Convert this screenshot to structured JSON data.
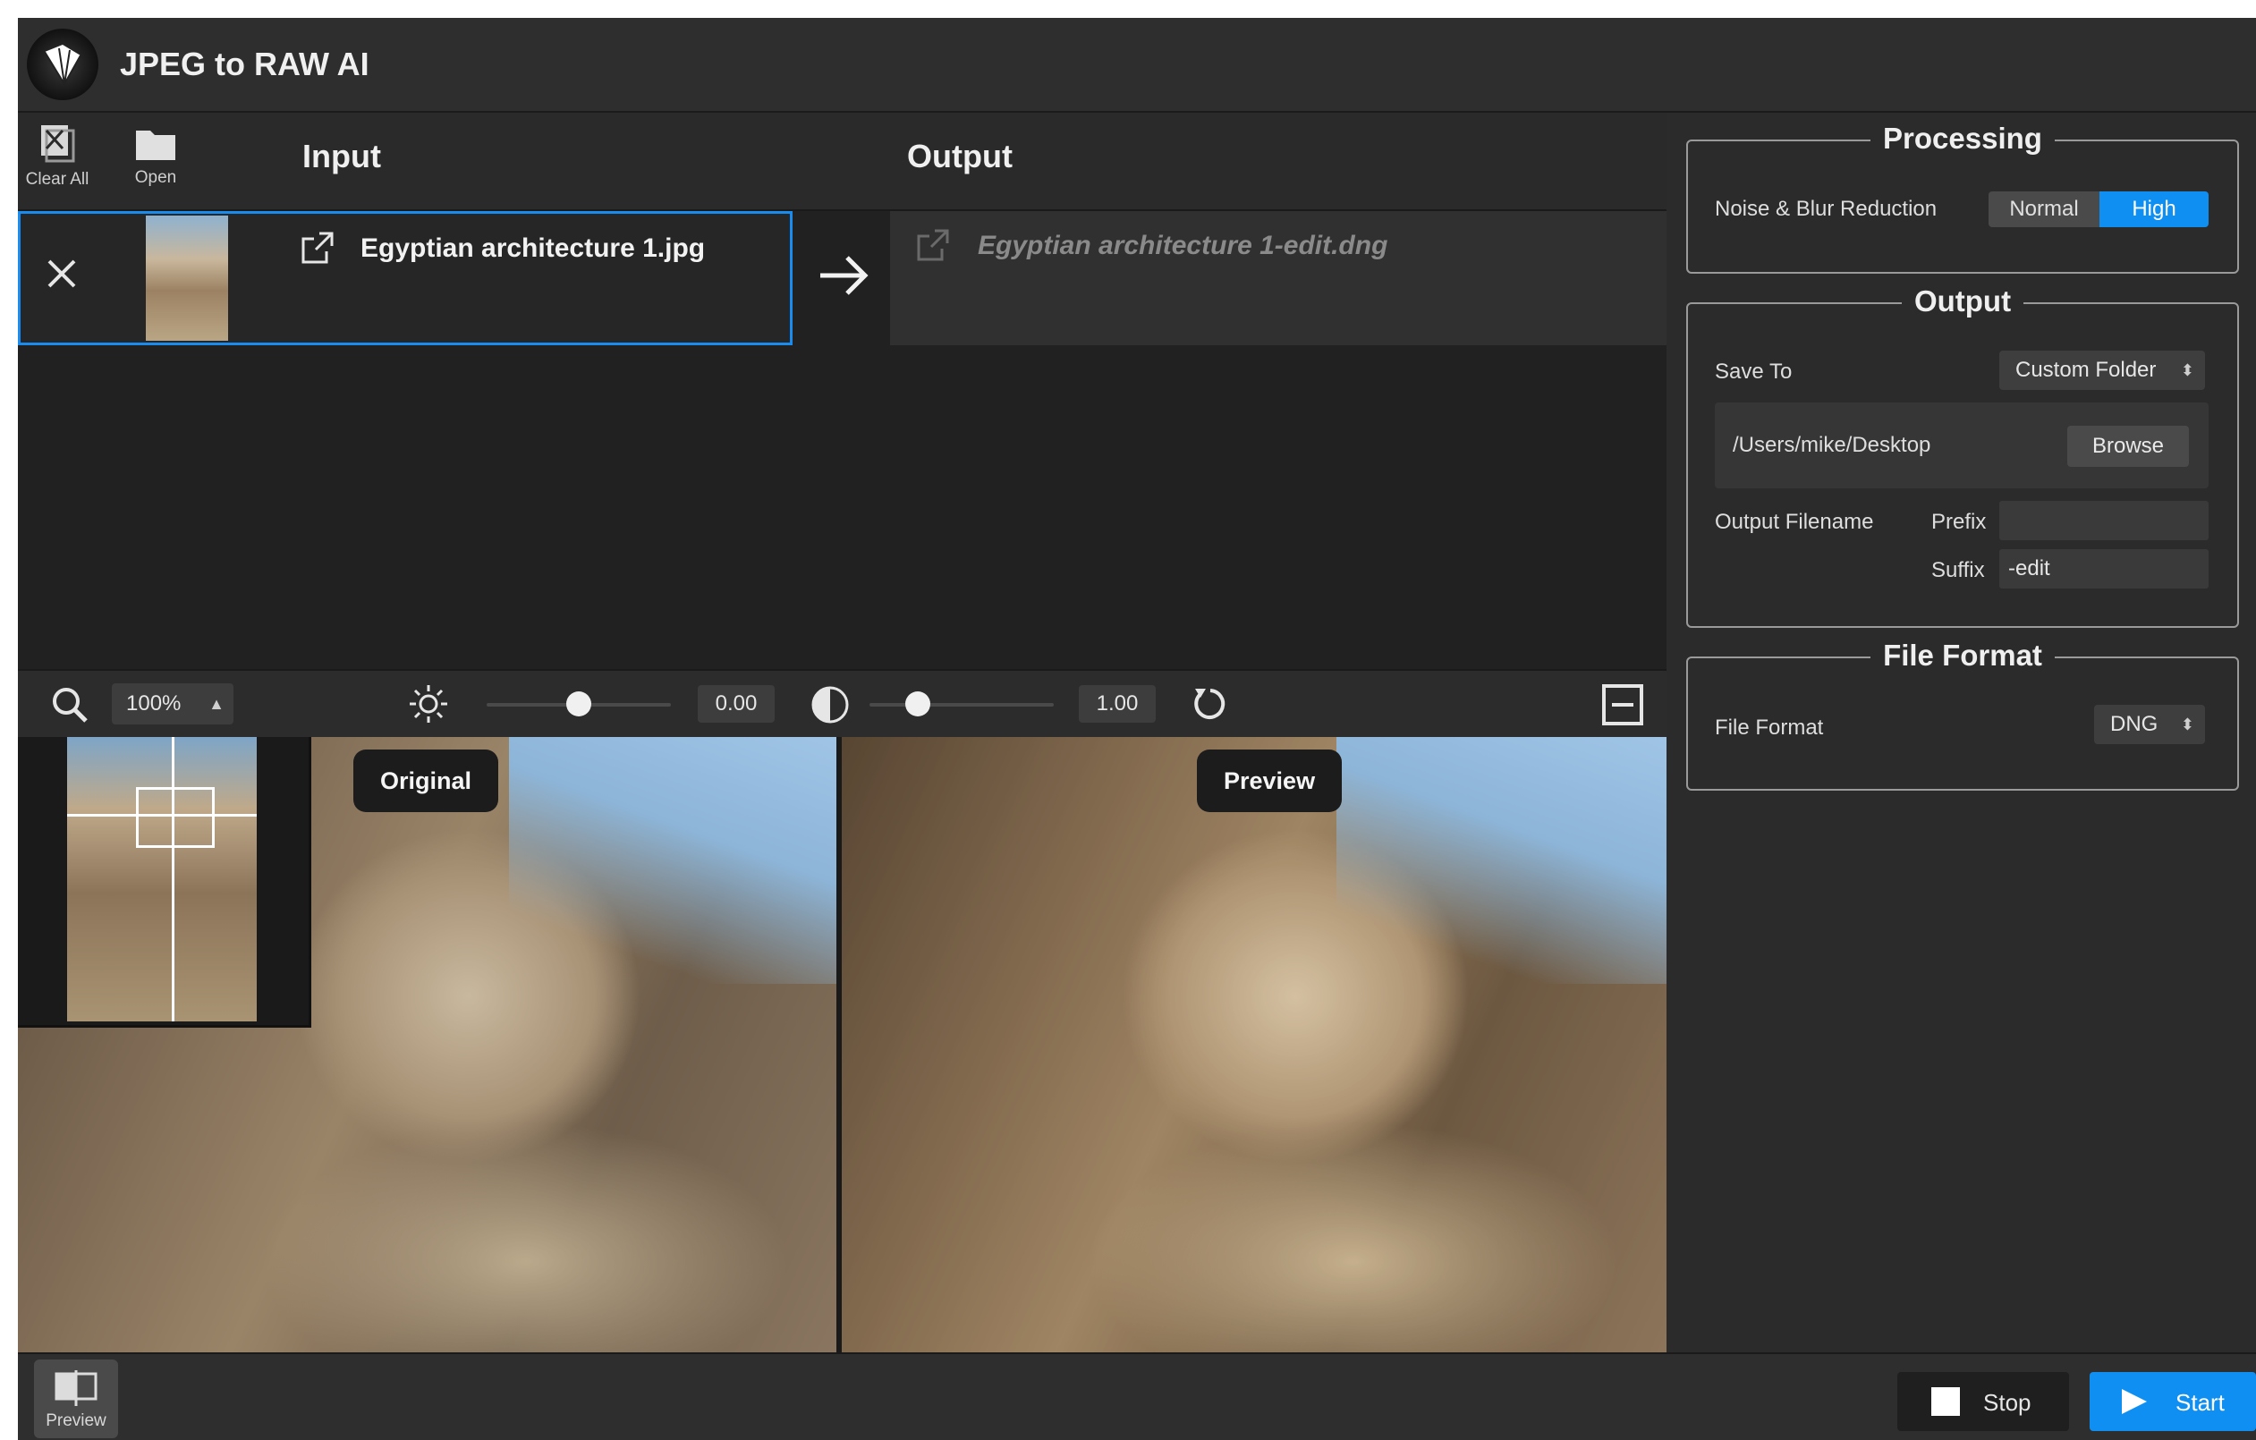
{
  "app": {
    "title": "JPEG to RAW AI"
  },
  "toolbar": {
    "clear_all_label": "Clear All",
    "open_label": "Open"
  },
  "columns": {
    "input_label": "Input",
    "output_label": "Output"
  },
  "file": {
    "input_name": "Egyptian architecture 1.jpg",
    "output_name": "Egyptian architecture 1-edit.dng"
  },
  "preview_toolbar": {
    "zoom": "100%",
    "exposure_value": "0.00",
    "exposure_level": 0.5,
    "contrast_value": "1.00",
    "contrast_level": 0.26
  },
  "panes": {
    "original_label": "Original",
    "preview_label": "Preview"
  },
  "sidebar": {
    "processing": {
      "title": "Processing",
      "noise_label": "Noise & Blur Reduction",
      "options": [
        "Normal",
        "High"
      ],
      "selected": "High"
    },
    "output": {
      "title": "Output",
      "save_to_label": "Save To",
      "save_to_value": "Custom Folder",
      "path": "/Users/mike/Desktop",
      "browse_label": "Browse",
      "filename_label": "Output Filename",
      "prefix_label": "Prefix",
      "prefix_value": "",
      "suffix_label": "Suffix",
      "suffix_value": "-edit"
    },
    "file_format": {
      "title": "File Format",
      "label": "File Format",
      "value": "DNG"
    }
  },
  "bottom": {
    "preview_label": "Preview",
    "stop_label": "Stop",
    "start_label": "Start"
  },
  "colors": {
    "accent": "#0f8ff2",
    "selection_border": "#1a8cf0"
  }
}
